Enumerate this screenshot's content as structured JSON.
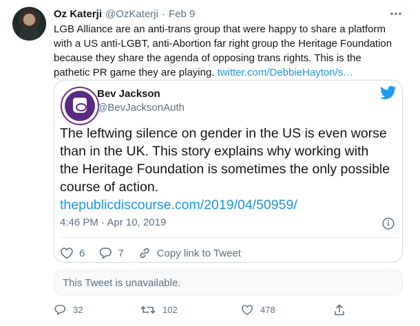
{
  "tweet": {
    "author_name": "Oz Katerji",
    "author_handle": "@OzKaterji",
    "separator": "·",
    "date": "Feb 9",
    "more_icon": "ellipsis-icon",
    "text_lines": [
      "LGB Alliance are an anti-trans group that were happy to share a platform",
      "with a US anti-LGBT, anti-Abortion far right group the Heritage Foundation",
      "because they share the agenda of opposing trans rights.  This is the",
      "pathetic PR game they are playing. "
    ],
    "link_text": "twitter.com/DebbieHayton/s…",
    "link_color": "#1b95e0"
  },
  "quote": {
    "author_name": "Bev Jackson",
    "author_handle": "@BevJacksonAuth",
    "platform_icon": "twitter-bird-icon",
    "text_lines": [
      "The leftwing silence on gender in the US is even worse",
      "than in the UK. This story explains why working with",
      "the Heritage Foundation is sometimes the only possible",
      "course of action."
    ],
    "link_text": "thepublicdiscourse.com/2019/04/50959/",
    "timestamp": "4:46 PM · Apr 10, 2019",
    "likes": "6",
    "replies": "7",
    "copy_link_label": "Copy link to Tweet"
  },
  "unavailable_notice": "This Tweet is unavailable.",
  "actions": {
    "replies": "32",
    "retweets": "102",
    "likes": "478"
  },
  "colors": {
    "text": "#0f1419",
    "secondary": "#5b7083",
    "accent": "#1b95e0",
    "border": "#cfd9de"
  }
}
